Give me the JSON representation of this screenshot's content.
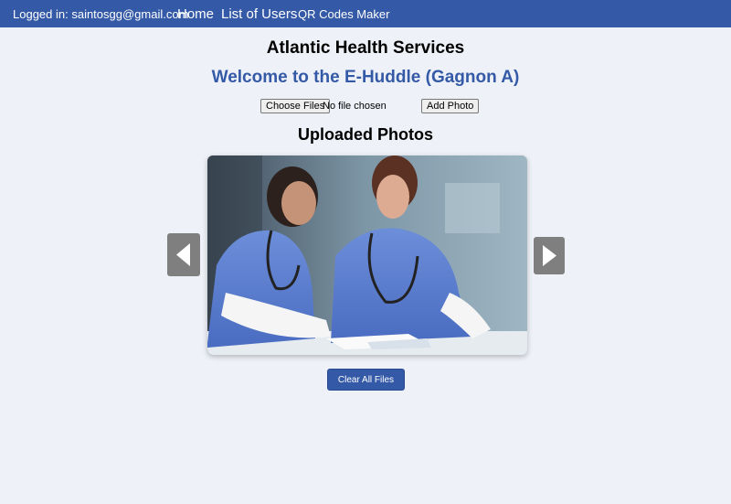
{
  "navbar": {
    "user_label": "Logged in: saintosgg@gmail.com",
    "links": [
      "Home",
      "List of Users",
      "QR Codes Maker"
    ]
  },
  "header": {
    "title": "Atlantic Health Services",
    "welcome": "Welcome to the E-Huddle (Gagnon A)"
  },
  "upload": {
    "choose_label": "Choose Files",
    "file_status": "No file chosen",
    "add_label": "Add Photo"
  },
  "gallery": {
    "title": "Uploaded Photos",
    "prev_icon": "triangle-left-icon",
    "next_icon": "triangle-right-icon"
  },
  "actions": {
    "clear_label": "Clear All Files"
  },
  "colors": {
    "brand": "#3459a7",
    "background": "#eef2f8",
    "carousel_button": "#7f7f7f"
  }
}
